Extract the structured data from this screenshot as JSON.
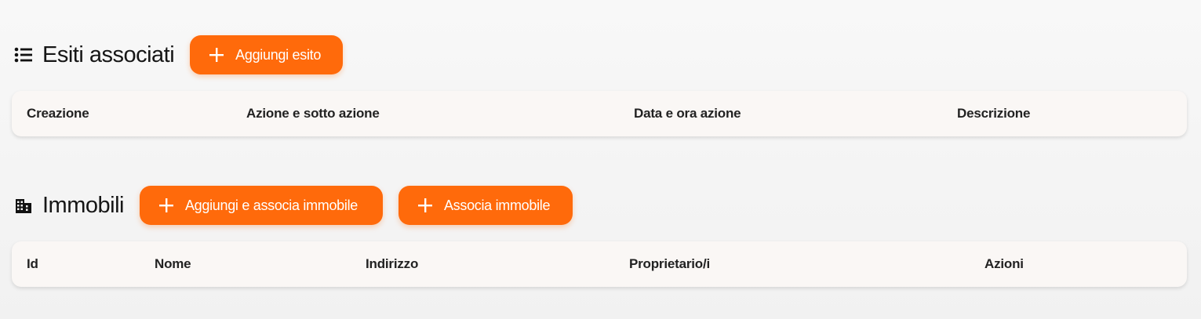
{
  "esiti": {
    "title": "Esiti associati",
    "icon": "list-icon",
    "add_button_label": "Aggiungi esito",
    "columns": [
      "Creazione",
      "Azione e sotto azione",
      "Data e ora azione",
      "Descrizione"
    ]
  },
  "immobili": {
    "title": "Immobili",
    "icon": "building-icon",
    "add_associate_button_label": "Aggiungi e associa immobile",
    "associate_button_label": "Associa immobile",
    "columns": [
      "Id",
      "Nome",
      "Indirizzo",
      "Proprietario/i",
      "Azioni"
    ]
  },
  "colors": {
    "accent": "#ff6a0b",
    "table_header_bg": "#faf7f5"
  }
}
